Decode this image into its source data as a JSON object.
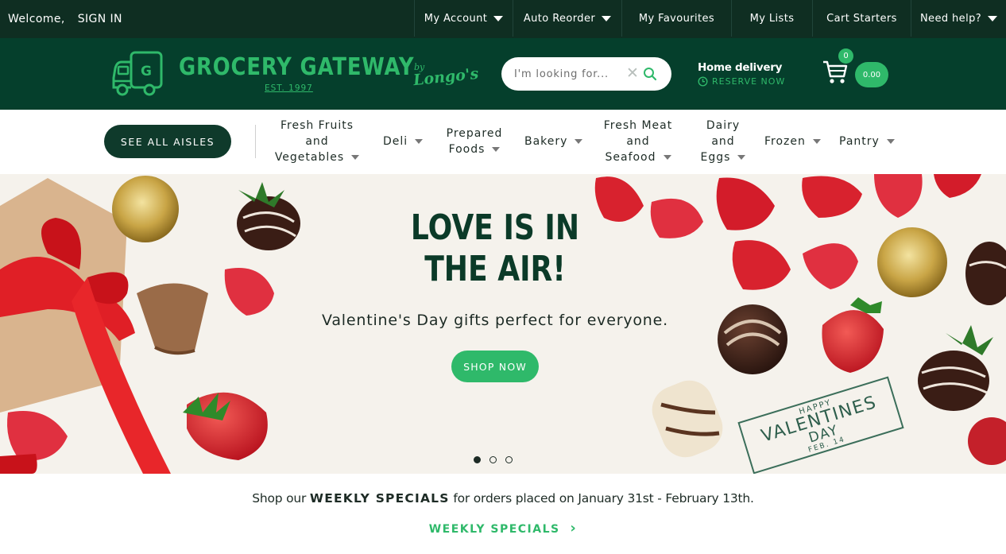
{
  "topbar": {
    "welcome": "Welcome,",
    "sign_in": "SIGN IN",
    "items": [
      "My Account",
      "Auto Reorder",
      "My Favourites",
      "My Lists",
      "Cart Starters",
      "Need help?"
    ]
  },
  "brand": {
    "name": "GROCERY GATEWAY",
    "est": "EST. 1997",
    "by": "by",
    "partner": "Longo's",
    "truck_letter": "G"
  },
  "search": {
    "placeholder": "I'm looking for...",
    "clear_symbol": "✕"
  },
  "delivery": {
    "title": "Home delivery",
    "reserve": "RESERVE NOW"
  },
  "cart": {
    "count": "0",
    "total": "0.00"
  },
  "nav": {
    "see_all": "SEE ALL AISLES",
    "categories": {
      "fruits_l1": "Fresh Fruits",
      "fruits_l2": "and",
      "fruits_l3": "Vegetables",
      "deli": "Deli",
      "prepared_l1": "Prepared",
      "prepared_l2": "Foods",
      "bakery": "Bakery",
      "meat_l1": "Fresh Meat",
      "meat_l2": "and",
      "meat_l3": "Seafood",
      "dairy_l1": "Dairy",
      "dairy_l2": "and",
      "dairy_l3": "Eggs",
      "frozen": "Frozen",
      "pantry": "Pantry"
    }
  },
  "hero": {
    "title_line1": "LOVE IS IN",
    "title_line2": "THE AIR!",
    "subtitle": "Valentine's Day gifts perfect for everyone.",
    "button": "SHOP NOW",
    "slide_count": 3,
    "active_slide": 1,
    "stamp": {
      "l1": "HAPPY",
      "l2": "VALENTINES",
      "l3": "DAY",
      "l4": "FEB. 14"
    }
  },
  "weekly": {
    "prefix": "Shop our ",
    "highlight": "WEEKLY SPECIALS",
    "suffix": " for orders placed on January 31st - February 13th.",
    "link": "WEEKLY SPECIALS",
    "link_arrow": "›"
  },
  "colors": {
    "topbar": "#0f2e22",
    "header": "#053f2c",
    "accent_green": "#2fb96a",
    "dark_button": "#0f3a2b",
    "hero_bg": "#f5f2ec"
  }
}
